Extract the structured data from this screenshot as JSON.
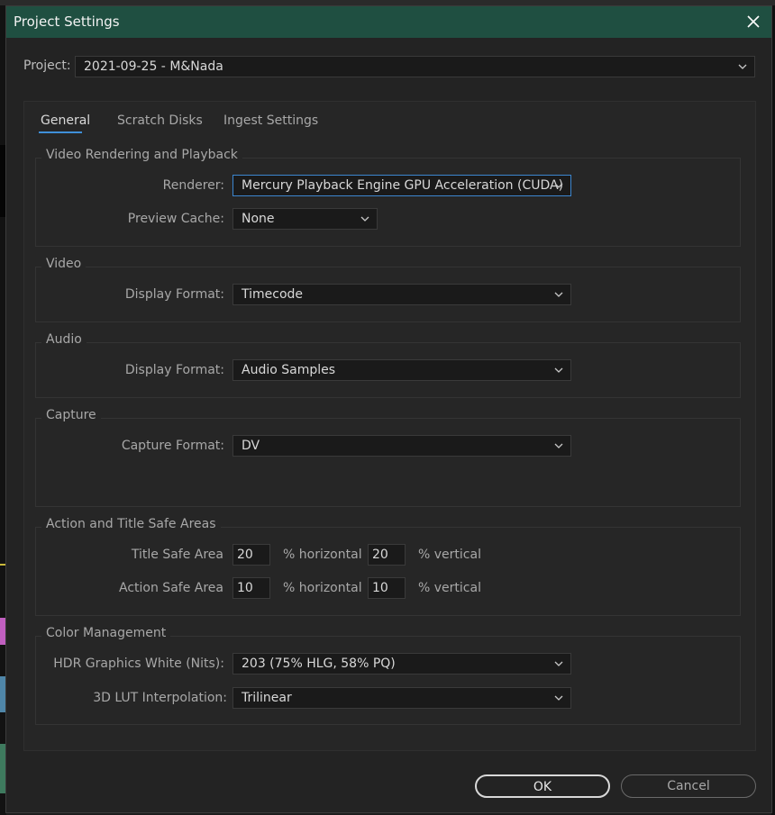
{
  "window": {
    "title": "Project Settings"
  },
  "project": {
    "label": "Project:",
    "value": "2021-09-25 - M&Nada"
  },
  "tabs": [
    {
      "label": "General",
      "active": true
    },
    {
      "label": "Scratch Disks",
      "active": false
    },
    {
      "label": "Ingest Settings",
      "active": false
    }
  ],
  "video_rendering": {
    "title": "Video Rendering and Playback",
    "renderer_label": "Renderer:",
    "renderer_value": "Mercury Playback Engine GPU Acceleration (CUDA)",
    "preview_cache_label": "Preview Cache:",
    "preview_cache_value": "None"
  },
  "video": {
    "title": "Video",
    "display_format_label": "Display Format:",
    "display_format_value": "Timecode"
  },
  "audio": {
    "title": "Audio",
    "display_format_label": "Display Format:",
    "display_format_value": "Audio Samples"
  },
  "capture": {
    "title": "Capture",
    "capture_format_label": "Capture Format:",
    "capture_format_value": "DV"
  },
  "safe_areas": {
    "title": "Action and Title Safe Areas",
    "title_safe_label": "Title Safe Area",
    "title_safe_h": "20",
    "title_safe_v": "20",
    "action_safe_label": "Action Safe Area",
    "action_safe_h": "10",
    "action_safe_v": "10",
    "horizontal_unit": "% horizontal",
    "vertical_unit": "% vertical"
  },
  "color_management": {
    "title": "Color Management",
    "hdr_label": "HDR Graphics White (Nits):",
    "hdr_value": "203 (75% HLG, 58% PQ)",
    "lut_label": "3D LUT Interpolation:",
    "lut_value": "Trilinear"
  },
  "buttons": {
    "ok": "OK",
    "cancel": "Cancel"
  },
  "colors": {
    "titlebar": "#1f4f41",
    "accent": "#3f8fd8",
    "background": "#232323"
  }
}
